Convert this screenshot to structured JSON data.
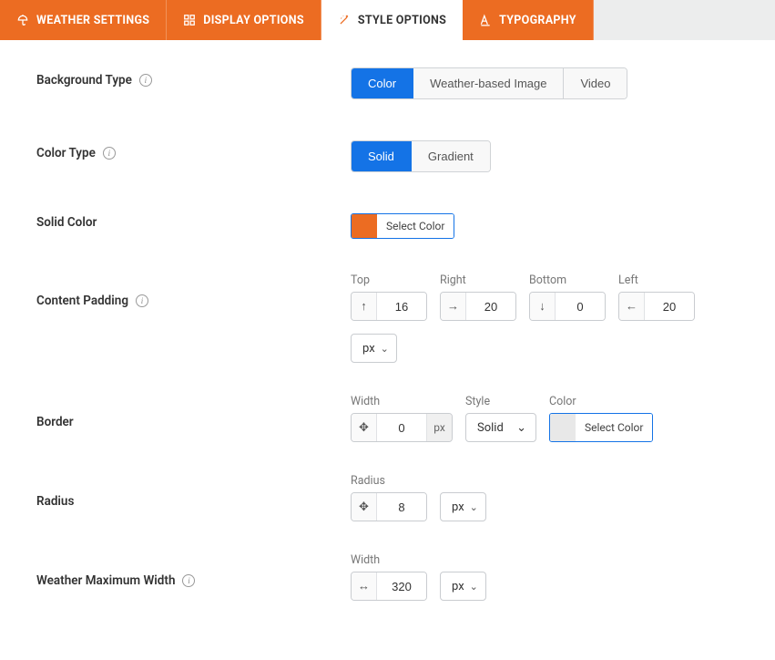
{
  "tabs": {
    "weather_settings": "WEATHER SETTINGS",
    "display_options": "DISPLAY OPTIONS",
    "style_options": "STYLE OPTIONS",
    "typography": "TYPOGRAPHY"
  },
  "labels": {
    "background_type": "Background Type",
    "color_type": "Color Type",
    "solid_color": "Solid Color",
    "content_padding": "Content Padding",
    "border": "Border",
    "radius": "Radius",
    "max_width": "Weather Maximum Width"
  },
  "bg_type": {
    "color": "Color",
    "weather_image": "Weather-based Image",
    "video": "Video"
  },
  "color_type": {
    "solid": "Solid",
    "gradient": "Gradient"
  },
  "select_color": "Select Color",
  "padding": {
    "top_label": "Top",
    "right_label": "Right",
    "bottom_label": "Bottom",
    "left_label": "Left",
    "top": "16",
    "right": "20",
    "bottom": "0",
    "left": "20",
    "unit": "px"
  },
  "border_sec": {
    "width_label": "Width",
    "style_label": "Style",
    "color_label": "Color",
    "width": "0",
    "width_unit": "px",
    "style": "Solid"
  },
  "radius_sec": {
    "radius_label": "Radius",
    "value": "8",
    "unit": "px"
  },
  "maxw": {
    "width_label": "Width",
    "value": "320",
    "unit": "px"
  },
  "colors": {
    "accent": "#ec6c22",
    "primary": "#1473e6"
  }
}
